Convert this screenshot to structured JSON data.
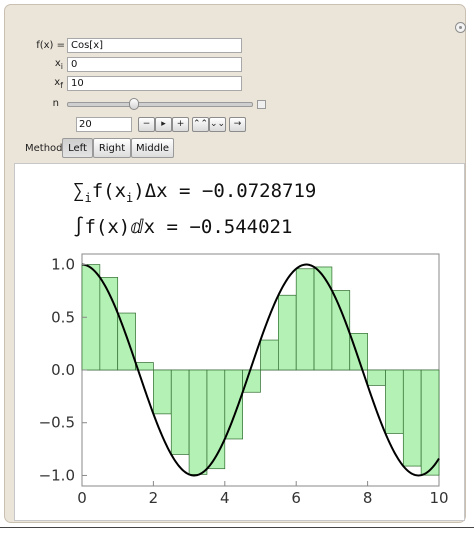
{
  "controls": {
    "f_label": "f(x) =",
    "f_value": "Cos[x]",
    "xi_label": "x",
    "xi_sub": "i",
    "xi_value": "0",
    "xf_label": "x",
    "xf_sub": "f",
    "xf_value": "10",
    "n_label": "n",
    "n_value": "20",
    "n_slider_fraction": 0.35,
    "buttons": [
      "−",
      "▸",
      "+",
      "⌃⌃",
      "⌄⌄",
      "→"
    ]
  },
  "method": {
    "label": "Method",
    "options": [
      "Left",
      "Right",
      "Middle"
    ],
    "selected": "Left"
  },
  "formulas": {
    "sum_lhs_prefix": "∑",
    "sum_lhs_sub": "i",
    "sum_lhs_body": "f(x",
    "sum_lhs_body_sub": "i",
    "sum_lhs_tail": ")Δx",
    "sum_rel": "=",
    "sum_value": "−0.0728719",
    "int_lhs": "∫f(x)ⅆx",
    "int_rel": "=",
    "int_value": "−0.544021"
  },
  "colors": {
    "bar_fill": "#b4f1b4",
    "bar_stroke": "#2e6b2e",
    "curve": "#000000",
    "axis": "#888888"
  },
  "chart_data": {
    "type": "bar",
    "function": "Cos[x]",
    "x_range": [
      0,
      10
    ],
    "n": 20,
    "method": "Left",
    "bar_width": 0.5,
    "bar_left_x": [
      0,
      0.5,
      1,
      1.5,
      2,
      2.5,
      3,
      3.5,
      4,
      4.5,
      5,
      5.5,
      6,
      6.5,
      7,
      7.5,
      8,
      8.5,
      9,
      9.5
    ],
    "values": [
      1.0,
      0.878,
      0.54,
      0.071,
      -0.416,
      -0.801,
      -0.99,
      -0.936,
      -0.654,
      -0.211,
      0.284,
      0.709,
      0.96,
      0.977,
      0.754,
      0.347,
      -0.146,
      -0.602,
      -0.911,
      -0.997
    ],
    "curve": "cos(x)",
    "xlim": [
      0,
      10
    ],
    "ylim": [
      -1.1,
      1.1
    ],
    "xticks": [
      "0",
      "2",
      "4",
      "6",
      "8",
      "10"
    ],
    "xtick_values": [
      0,
      2,
      4,
      6,
      8,
      10
    ],
    "yticks": [
      "1.0",
      "0.5",
      "0.0",
      "−0.5",
      "−1.0"
    ],
    "ytick_values": [
      1.0,
      0.5,
      0.0,
      -0.5,
      -1.0
    ],
    "xlabel": "",
    "ylabel": "",
    "grid": false
  }
}
